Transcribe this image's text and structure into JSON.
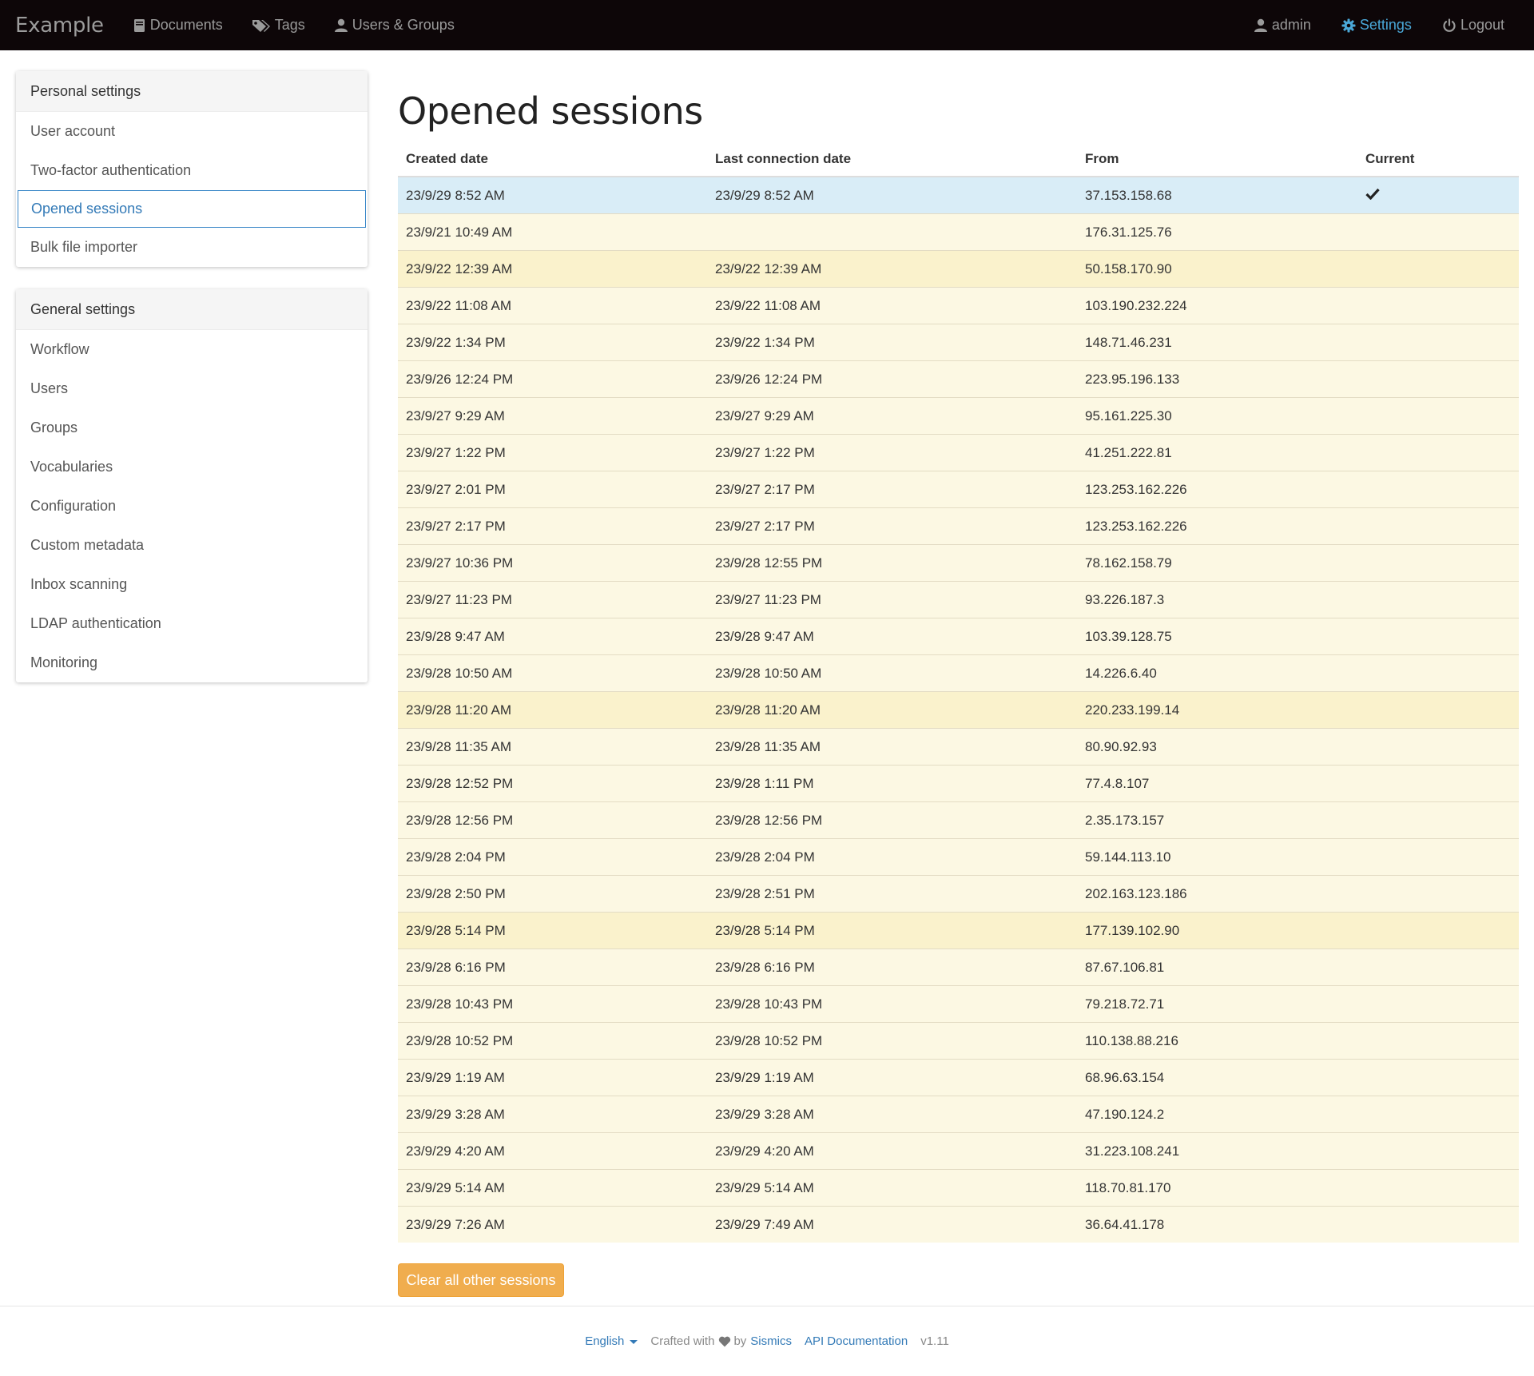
{
  "navbar": {
    "brand": "Example",
    "left_items": [
      {
        "label": "Documents",
        "icon": "book-icon"
      },
      {
        "label": "Tags",
        "icon": "tags-icon"
      },
      {
        "label": "Users & Groups",
        "icon": "user-icon"
      }
    ],
    "right_items": [
      {
        "label": "admin",
        "icon": "user-icon"
      },
      {
        "label": "Settings",
        "icon": "gear-icon"
      },
      {
        "label": "Logout",
        "icon": "power-icon"
      }
    ],
    "active_color": "#4aa8d8"
  },
  "personal_settings": {
    "title": "Personal settings",
    "items": [
      {
        "label": "User account"
      },
      {
        "label": "Two-factor authentication"
      },
      {
        "label": "Opened sessions"
      },
      {
        "label": "Bulk file importer"
      }
    ],
    "active_index": 2
  },
  "general_settings": {
    "title": "General settings",
    "items": [
      {
        "label": "Workflow"
      },
      {
        "label": "Users"
      },
      {
        "label": "Groups"
      },
      {
        "label": "Vocabularies"
      },
      {
        "label": "Configuration"
      },
      {
        "label": "Custom metadata"
      },
      {
        "label": "Inbox scanning"
      },
      {
        "label": "LDAP authentication"
      },
      {
        "label": "Monitoring"
      }
    ]
  },
  "main": {
    "title": "Opened sessions",
    "columns": [
      "Created date",
      "Last connection date",
      "From",
      "Current"
    ],
    "rows": [
      {
        "created": "23/9/29 8:52 AM",
        "last": "23/9/29 8:52 AM",
        "from": "37.153.158.68",
        "current": true
      },
      {
        "created": "23/9/21 10:49 AM",
        "last": "",
        "from": "176.31.125.76",
        "current": false
      },
      {
        "created": "23/9/22 12:39 AM",
        "last": "23/9/22 12:39 AM",
        "from": "50.158.170.90",
        "current": false
      },
      {
        "created": "23/9/22 11:08 AM",
        "last": "23/9/22 11:08 AM",
        "from": "103.190.232.224",
        "current": false
      },
      {
        "created": "23/9/22 1:34 PM",
        "last": "23/9/22 1:34 PM",
        "from": "148.71.46.231",
        "current": false
      },
      {
        "created": "23/9/26 12:24 PM",
        "last": "23/9/26 12:24 PM",
        "from": "223.95.196.133",
        "current": false
      },
      {
        "created": "23/9/27 9:29 AM",
        "last": "23/9/27 9:29 AM",
        "from": "95.161.225.30",
        "current": false
      },
      {
        "created": "23/9/27 1:22 PM",
        "last": "23/9/27 1:22 PM",
        "from": "41.251.222.81",
        "current": false
      },
      {
        "created": "23/9/27 2:01 PM",
        "last": "23/9/27 2:17 PM",
        "from": "123.253.162.226",
        "current": false
      },
      {
        "created": "23/9/27 2:17 PM",
        "last": "23/9/27 2:17 PM",
        "from": "123.253.162.226",
        "current": false
      },
      {
        "created": "23/9/27 10:36 PM",
        "last": "23/9/28 12:55 PM",
        "from": "78.162.158.79",
        "current": false
      },
      {
        "created": "23/9/27 11:23 PM",
        "last": "23/9/27 11:23 PM",
        "from": "93.226.187.3",
        "current": false
      },
      {
        "created": "23/9/28 9:47 AM",
        "last": "23/9/28 9:47 AM",
        "from": "103.39.128.75",
        "current": false
      },
      {
        "created": "23/9/28 10:50 AM",
        "last": "23/9/28 10:50 AM",
        "from": "14.226.6.40",
        "current": false
      },
      {
        "created": "23/9/28 11:20 AM",
        "last": "23/9/28 11:20 AM",
        "from": "220.233.199.14",
        "current": false
      },
      {
        "created": "23/9/28 11:35 AM",
        "last": "23/9/28 11:35 AM",
        "from": "80.90.92.93",
        "current": false
      },
      {
        "created": "23/9/28 12:52 PM",
        "last": "23/9/28 1:11 PM",
        "from": "77.4.8.107",
        "current": false
      },
      {
        "created": "23/9/28 12:56 PM",
        "last": "23/9/28 12:56 PM",
        "from": "2.35.173.157",
        "current": false
      },
      {
        "created": "23/9/28 2:04 PM",
        "last": "23/9/28 2:04 PM",
        "from": "59.144.113.10",
        "current": false
      },
      {
        "created": "23/9/28 2:50 PM",
        "last": "23/9/28 2:51 PM",
        "from": "202.163.123.186",
        "current": false
      },
      {
        "created": "23/9/28 5:14 PM",
        "last": "23/9/28 5:14 PM",
        "from": "177.139.102.90",
        "current": false
      },
      {
        "created": "23/9/28 6:16 PM",
        "last": "23/9/28 6:16 PM",
        "from": "87.67.106.81",
        "current": false
      },
      {
        "created": "23/9/28 10:43 PM",
        "last": "23/9/28 10:43 PM",
        "from": "79.218.72.71",
        "current": false
      },
      {
        "created": "23/9/28 10:52 PM",
        "last": "23/9/28 10:52 PM",
        "from": "110.138.88.216",
        "current": false
      },
      {
        "created": "23/9/29 1:19 AM",
        "last": "23/9/29 1:19 AM",
        "from": "68.96.63.154",
        "current": false
      },
      {
        "created": "23/9/29 3:28 AM",
        "last": "23/9/29 3:28 AM",
        "from": "47.190.124.2",
        "current": false
      },
      {
        "created": "23/9/29 4:20 AM",
        "last": "23/9/29 4:20 AM",
        "from": "31.223.108.241",
        "current": false
      },
      {
        "created": "23/9/29 5:14 AM",
        "last": "23/9/29 5:14 AM",
        "from": "118.70.81.170",
        "current": false
      },
      {
        "created": "23/9/29 7:26 AM",
        "last": "23/9/29 7:49 AM",
        "from": "36.64.41.178",
        "current": false
      }
    ],
    "clear_button": "Clear all other sessions",
    "colors": {
      "current_row": "#d9edf7",
      "row": "#fcf8e3",
      "button": "#f0ad4e"
    }
  },
  "footer": {
    "language": "English",
    "crafted_with": "Crafted with",
    "by": "by",
    "company": "Sismics",
    "api_docs": "API Documentation",
    "version": "v1.11"
  }
}
